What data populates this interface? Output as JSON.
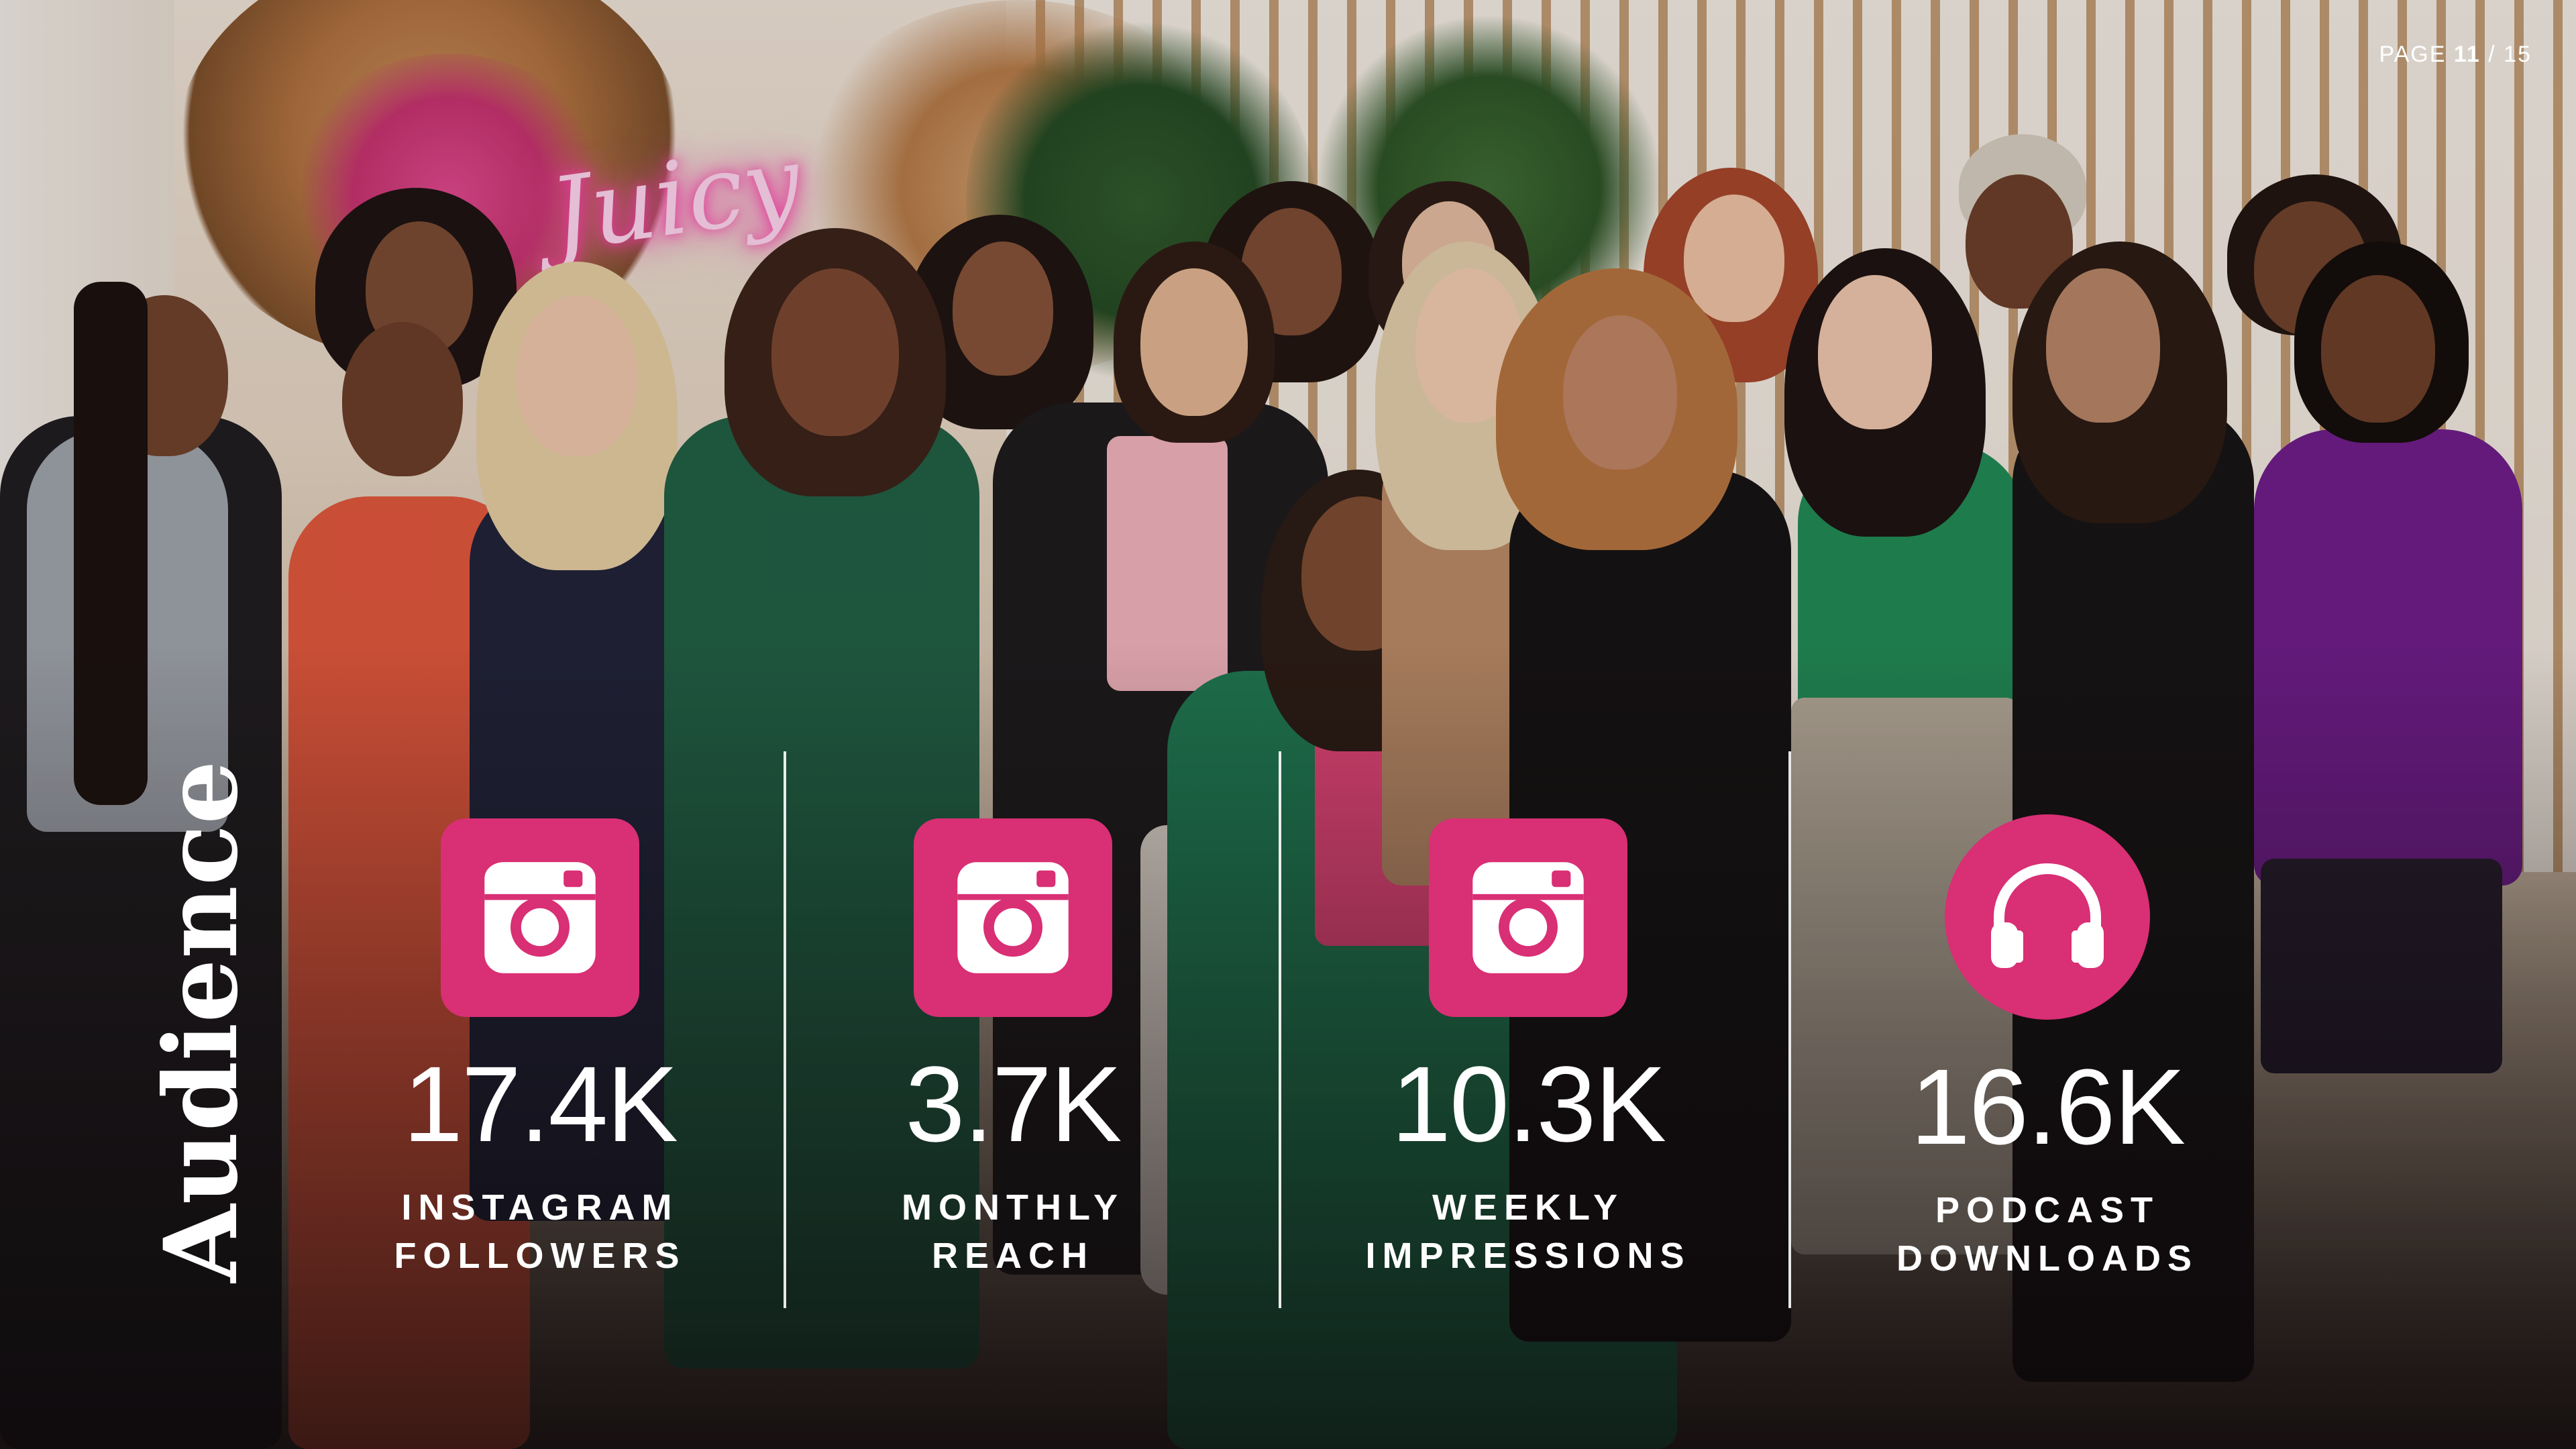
{
  "page": {
    "prefix": "PAGE",
    "current": "11",
    "separator": "/",
    "total": "15"
  },
  "title": "Audience",
  "neon_sign": "Juicy",
  "accent_color": "#d92f74",
  "stats": [
    {
      "icon": "instagram-icon",
      "value": "17.4K",
      "label_line1": "INSTAGRAM",
      "label_line2": "FOLLOWERS"
    },
    {
      "icon": "instagram-icon",
      "value": "3.7K",
      "label_line1": "MONTHLY",
      "label_line2": "REACH"
    },
    {
      "icon": "instagram-icon",
      "value": "10.3K",
      "label_line1": "WEEKLY",
      "label_line2": "IMPRESSIONS"
    },
    {
      "icon": "headphones-icon",
      "value": "16.6K",
      "label_line1": "PODCAST",
      "label_line2": "DOWNLOADS"
    }
  ]
}
